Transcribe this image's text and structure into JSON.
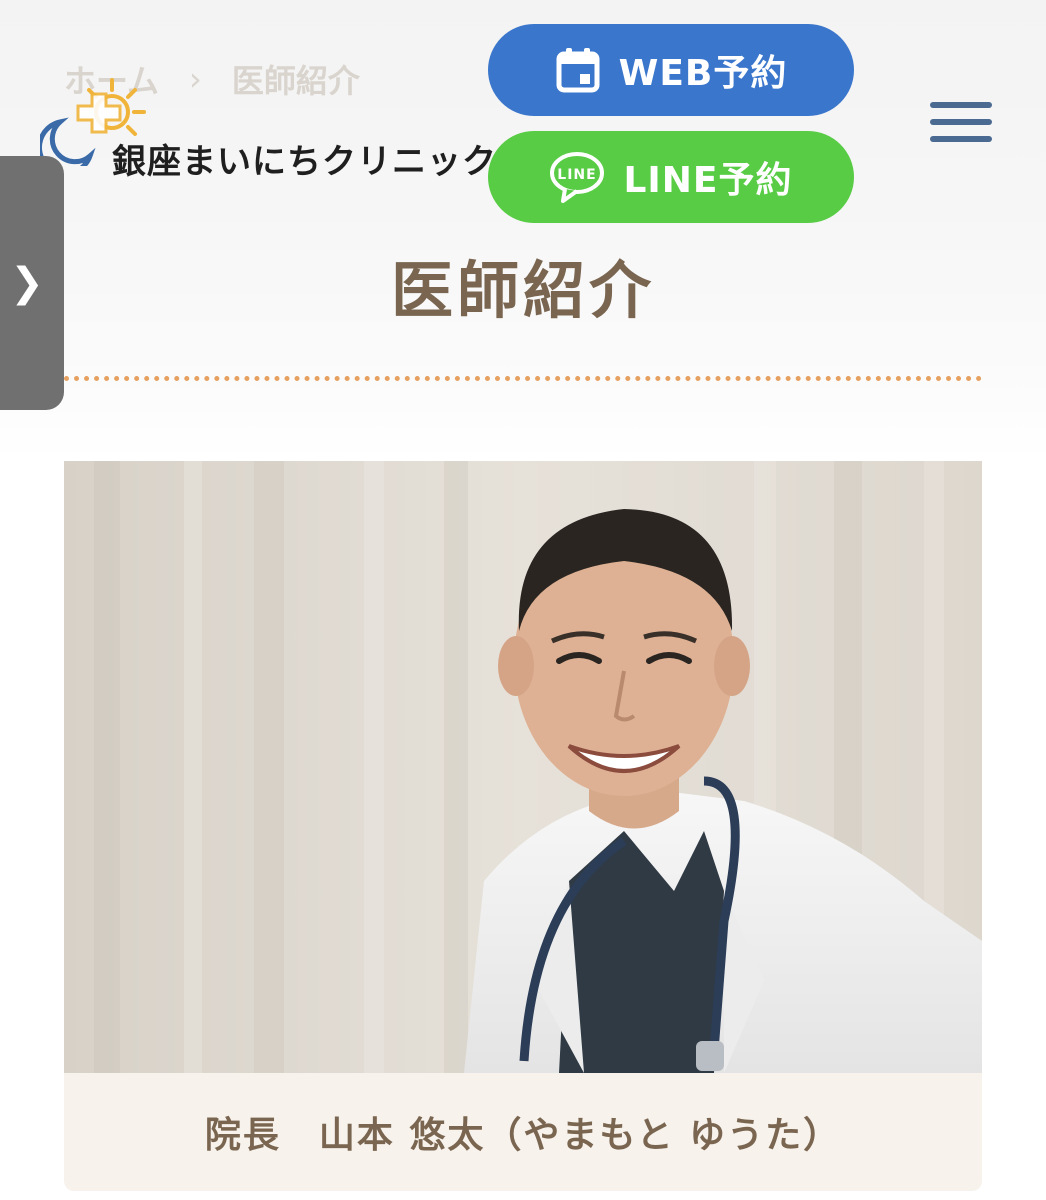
{
  "breadcrumb": {
    "home": "ホーム",
    "separator": "›",
    "current": "医師紹介"
  },
  "header": {
    "logo_text": "銀座まいにちクリニック",
    "web_reserve_label": "WEB予約",
    "line_reserve_label": "LINE予約",
    "line_icon_text": "LINE"
  },
  "side_tab": {
    "arrow": "❯"
  },
  "page": {
    "heading": "医師紹介"
  },
  "doctor": {
    "caption": "院長　山本 悠太（やまもと ゆうた）"
  },
  "colors": {
    "web_button": "#3a76cc",
    "line_button": "#58cc45",
    "heading": "#7a6650",
    "dotted_line": "#e6a060",
    "menu_icon": "#4a6a92"
  }
}
